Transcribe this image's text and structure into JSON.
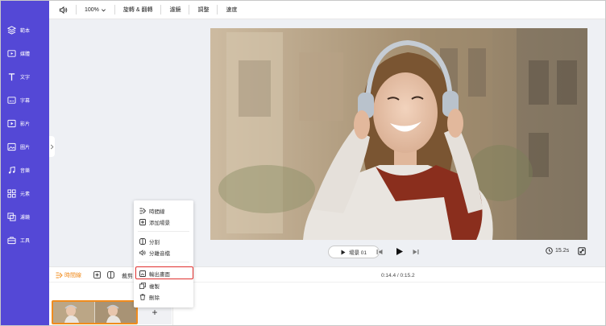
{
  "sidebar": {
    "items": [
      {
        "label": "範本",
        "icon": "template-layers-icon"
      },
      {
        "label": "媒體",
        "icon": "media-folder-icon"
      },
      {
        "label": "文字",
        "icon": "text-icon"
      },
      {
        "label": "字幕",
        "icon": "subtitles-icon"
      },
      {
        "label": "影片",
        "icon": "video-icon"
      },
      {
        "label": "圖片",
        "icon": "image-icon"
      },
      {
        "label": "音樂",
        "icon": "music-icon"
      },
      {
        "label": "元素",
        "icon": "elements-icon"
      },
      {
        "label": "濾鏡",
        "icon": "filter-icon"
      },
      {
        "label": "工具",
        "icon": "toolbox-icon"
      }
    ]
  },
  "toolbar": {
    "zoom": "100%",
    "rotate_flip": "旋轉 & 翻轉",
    "filter": "濾鏡",
    "adjust": "調整",
    "speed": "速度"
  },
  "player": {
    "scene_label": "場景 01",
    "duration": "15.2s"
  },
  "timeline": {
    "tab_label": "時間線",
    "cut_label": "裁剪",
    "time": "0:14.4 / 0:15.2",
    "add_scene": "+"
  },
  "context_menu": {
    "items": [
      {
        "label": "時間線",
        "icon": "timeline-icon"
      },
      {
        "label": "添加場景",
        "icon": "add-scene-icon"
      },
      {
        "label": "分割",
        "icon": "split-icon"
      },
      {
        "label": "分離音檔",
        "icon": "detach-audio-icon"
      },
      {
        "label": "輸出畫面",
        "icon": "export-frame-icon",
        "highlighted": true
      },
      {
        "label": "複製",
        "icon": "copy-icon"
      },
      {
        "label": "刪除",
        "icon": "delete-icon"
      }
    ]
  },
  "colors": {
    "sidebar": "#5448d6",
    "accent": "#f08c1e",
    "highlight": "#e0302e",
    "stage": "#eef0f4"
  }
}
